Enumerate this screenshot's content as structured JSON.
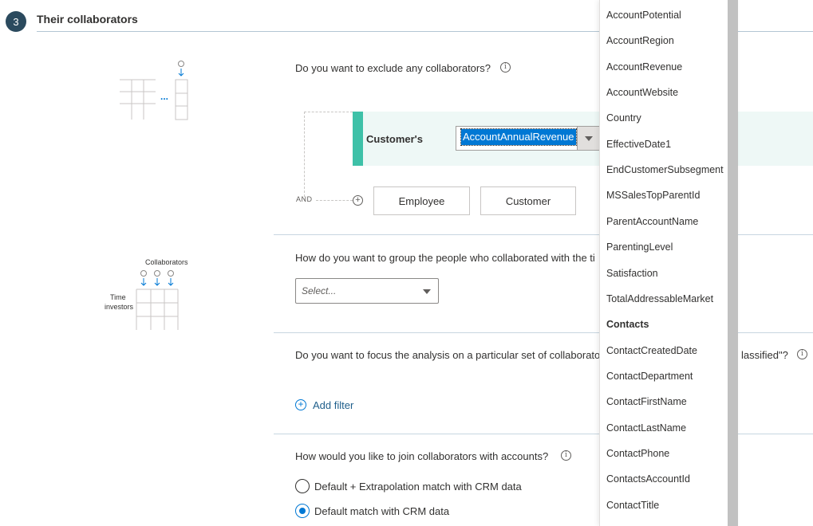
{
  "section": {
    "step": "3",
    "title": "Their collaborators"
  },
  "q1": {
    "text": "Do you want to exclude any collaborators?",
    "condition_label": "Customer's",
    "selected_value": "AccountAnnualRevenue",
    "and_label": "AND",
    "buttons": [
      "Employee",
      "Customer"
    ]
  },
  "illustration1": {
    "ellipsis": "..."
  },
  "illustration2": {
    "title": "Collaborators",
    "row_label_1": "Time",
    "row_label_2": "investors"
  },
  "q2": {
    "text": "How do you want to group the people who collaborated with the ti",
    "select_placeholder": "Select..."
  },
  "q3": {
    "text": "Do you want to focus the analysis on a particular set of collaborato",
    "text_tail": "lassified\"?",
    "add_filter": "Add filter"
  },
  "q4": {
    "text": "How would you like to join collaborators with accounts?",
    "options": [
      {
        "label": "Default + Extrapolation match with CRM data",
        "checked": false
      },
      {
        "label": "Default match with CRM data",
        "checked": true
      }
    ]
  },
  "dropdown": {
    "items": [
      {
        "label": "AccountPotential",
        "header": false
      },
      {
        "label": "AccountRegion",
        "header": false
      },
      {
        "label": "AccountRevenue",
        "header": false
      },
      {
        "label": "AccountWebsite",
        "header": false
      },
      {
        "label": "Country",
        "header": false
      },
      {
        "label": "EffectiveDate1",
        "header": false
      },
      {
        "label": "EndCustomerSubsegment",
        "header": false
      },
      {
        "label": "MSSalesTopParentId",
        "header": false
      },
      {
        "label": "ParentAccountName",
        "header": false
      },
      {
        "label": "ParentingLevel",
        "header": false
      },
      {
        "label": "Satisfaction",
        "header": false
      },
      {
        "label": "TotalAddressableMarket",
        "header": false
      },
      {
        "label": "Contacts",
        "header": true
      },
      {
        "label": "ContactCreatedDate",
        "header": false
      },
      {
        "label": "ContactDepartment",
        "header": false
      },
      {
        "label": "ContactFirstName",
        "header": false
      },
      {
        "label": "ContactLastName",
        "header": false
      },
      {
        "label": "ContactPhone",
        "header": false
      },
      {
        "label": "ContactsAccountId",
        "header": false
      },
      {
        "label": "ContactTitle",
        "header": false
      }
    ]
  },
  "colors": {
    "accent": "#0078d4",
    "teal": "#3ec1a8",
    "badge": "#2b4a5e"
  }
}
